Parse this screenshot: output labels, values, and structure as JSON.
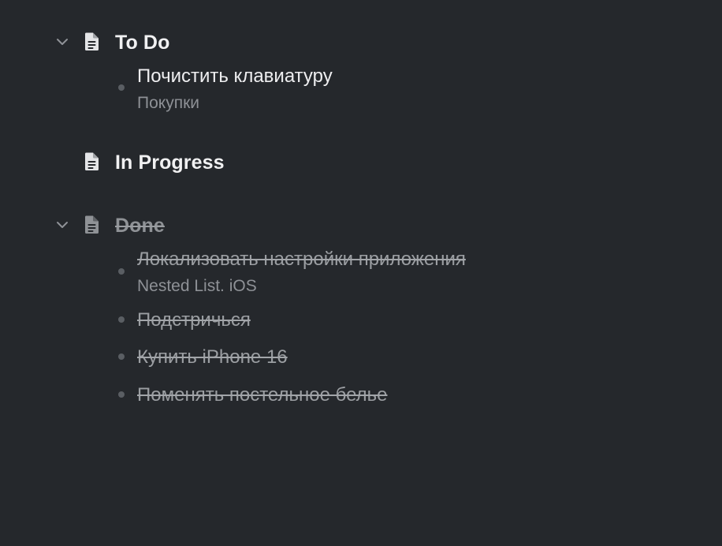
{
  "groups": [
    {
      "title": "To Do",
      "collapsed": false,
      "done": false,
      "icon": "document-icon",
      "items": [
        {
          "title": "Почистить клавиатуру",
          "subtitle": "Покупки",
          "done": false
        }
      ]
    },
    {
      "title": "In Progress",
      "collapsed": false,
      "done": false,
      "icon": "document-icon",
      "items": []
    },
    {
      "title": "Done",
      "collapsed": false,
      "done": true,
      "icon": "document-icon",
      "items": [
        {
          "title": "Локализовать настройки приложения",
          "subtitle": "Nested List. iOS",
          "done": true
        },
        {
          "title": "Подстричься",
          "done": true
        },
        {
          "title": "Купить iPhone 16",
          "done": true
        },
        {
          "title": "Поменять постельное белье",
          "done": true
        }
      ]
    }
  ],
  "colors": {
    "background": "#25282c",
    "title": "#f1f1f2",
    "subtitle": "#8e9196",
    "done_text": "#9b9ea2",
    "bullet": "#5a5e63",
    "icon": "#e4e5e7"
  }
}
